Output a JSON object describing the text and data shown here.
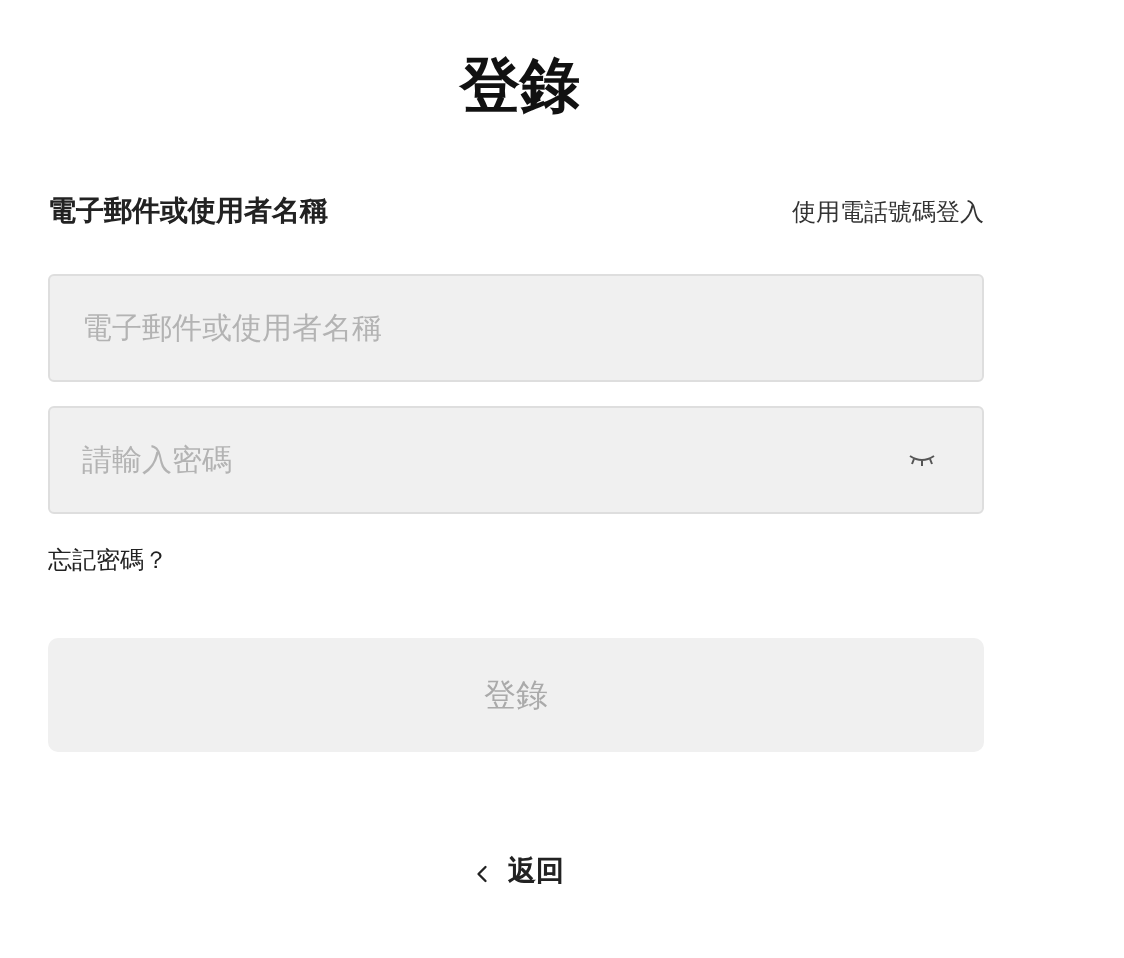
{
  "title": "登錄",
  "account_label": "電子郵件或使用者名稱",
  "phone_login_link": "使用電話號碼登入",
  "username_field": {
    "placeholder": "電子郵件或使用者名稱"
  },
  "password_field": {
    "placeholder": "請輸入密碼",
    "password_visible": false
  },
  "forgot_password_link": "忘記密碼？",
  "login_button": {
    "label": "登錄",
    "disabled": true
  },
  "back_link": "返回"
}
